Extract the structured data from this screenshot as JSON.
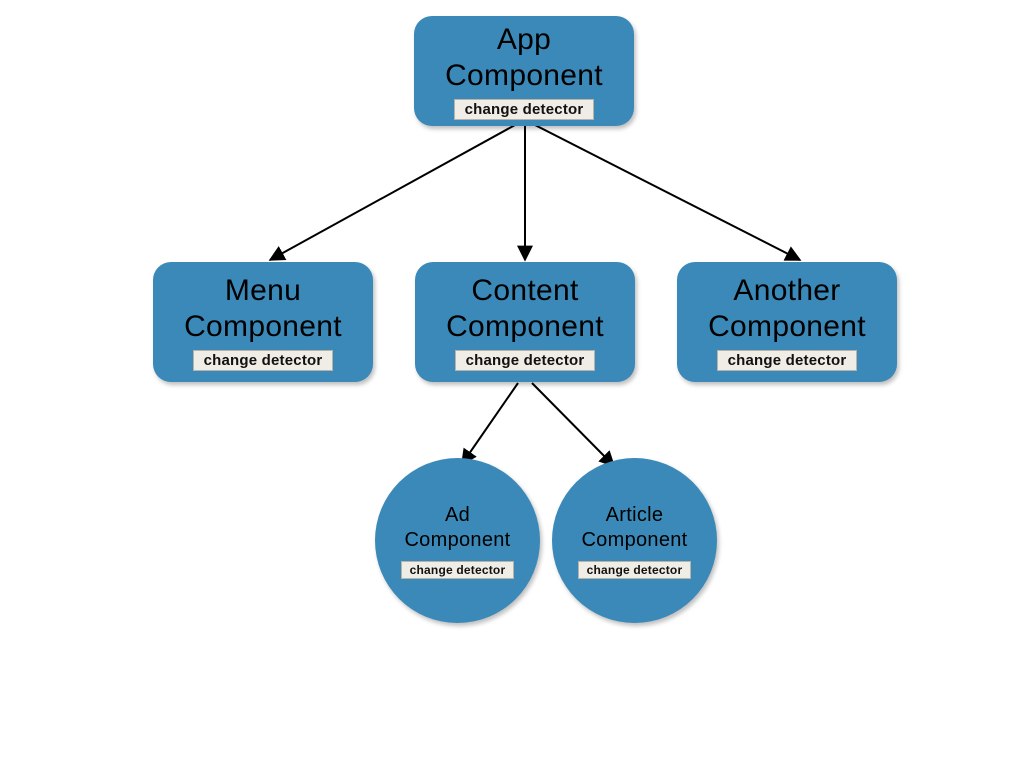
{
  "colors": {
    "node_fill": "#3a89b8",
    "badge_fill": "#f0ece6",
    "badge_border": "#b9b2a7"
  },
  "badge_label": "change detector",
  "nodes": {
    "app": {
      "line1": "App",
      "line2": "Component"
    },
    "menu": {
      "line1": "Menu",
      "line2": "Component"
    },
    "content": {
      "line1": "Content",
      "line2": "Component"
    },
    "another": {
      "line1": "Another",
      "line2": "Component"
    },
    "ad": {
      "line1": "Ad",
      "line2": "Component"
    },
    "article": {
      "line1": "Article",
      "line2": "Component"
    }
  },
  "edges": [
    {
      "from": "app",
      "to": "menu"
    },
    {
      "from": "app",
      "to": "content"
    },
    {
      "from": "app",
      "to": "another"
    },
    {
      "from": "content",
      "to": "ad"
    },
    {
      "from": "content",
      "to": "article"
    }
  ]
}
